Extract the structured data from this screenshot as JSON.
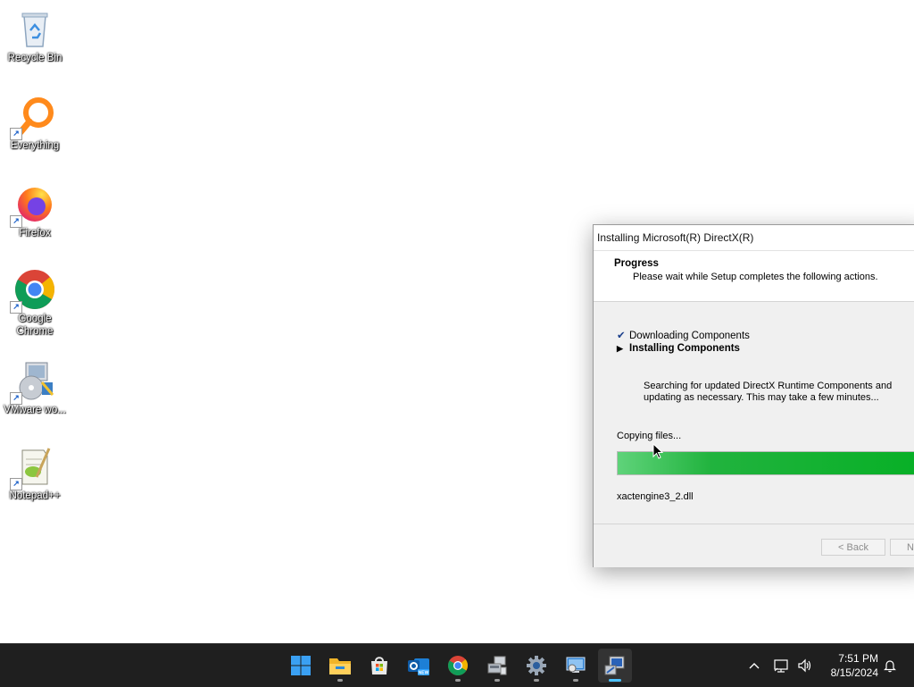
{
  "desktop": {
    "icons": [
      {
        "label": "Recycle Bin",
        "icon": "recycle-bin-icon"
      },
      {
        "label": "Everything",
        "icon": "everything-search-icon"
      },
      {
        "label": "Firefox",
        "icon": "firefox-icon"
      },
      {
        "label": "Google Chrome",
        "icon": "chrome-icon"
      },
      {
        "label": "VMware wo...",
        "icon": "vmware-workstation-icon"
      },
      {
        "label": "Notepad++",
        "icon": "notepad-plus-plus-icon"
      }
    ]
  },
  "dialog": {
    "title": "Installing Microsoft(R) DirectX(R)",
    "header_title": "Progress",
    "header_subtitle": "Please wait while Setup completes the following actions.",
    "steps": [
      {
        "marker": "✔",
        "label": "Downloading Components",
        "state": "done"
      },
      {
        "marker": "▶",
        "label": "Installing Components",
        "state": "current"
      }
    ],
    "description": "Searching for updated DirectX Runtime Components and updating as necessary. This may take a few minutes...",
    "status_text": "Copying files...",
    "progress_percent": 100,
    "progress_color": "#06b025",
    "current_file": "xactengine3_2.dll",
    "back_label": "< Back",
    "next_label": "Next >"
  },
  "taskbar": {
    "apps": [
      {
        "icon": "start-windows-icon",
        "active": false,
        "running": false
      },
      {
        "icon": "file-explorer-icon",
        "active": false,
        "running": true
      },
      {
        "icon": "microsoft-store-icon",
        "active": false,
        "running": false
      },
      {
        "icon": "outlook-new-icon",
        "active": false,
        "running": false
      },
      {
        "icon": "chrome-icon",
        "active": false,
        "running": true
      },
      {
        "icon": "device-manager-icon",
        "active": false,
        "running": true
      },
      {
        "icon": "settings-gear-icon",
        "active": false,
        "running": true
      },
      {
        "icon": "remote-desktop-icon",
        "active": false,
        "running": true
      },
      {
        "icon": "directx-setup-icon",
        "active": true,
        "running": true
      }
    ],
    "tray": {
      "time": "7:51 PM",
      "date": "8/15/2024"
    }
  }
}
